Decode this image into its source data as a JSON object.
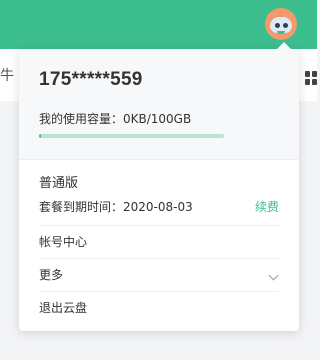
{
  "header": {
    "strip_glyph": "牛"
  },
  "account": {
    "phone": "175*****559",
    "storage_text": "我的使用容量：0KB/100GB",
    "storage_used_fraction": 0.012
  },
  "plan": {
    "name": "普通版",
    "expire_text": "套餐到期时间：2020-08-03",
    "renew_label": "续费"
  },
  "menu": {
    "items": [
      {
        "label": "帐号中心"
      },
      {
        "label": "更多"
      },
      {
        "label": "退出云盘"
      }
    ]
  },
  "colors": {
    "accent": "#3cbd8e",
    "avatar_bg": "#f29a6c"
  },
  "icons": {
    "avatar": "robot-avatar-icon",
    "grid": "grid-view-icon",
    "chevron": "chevron-down-icon"
  }
}
